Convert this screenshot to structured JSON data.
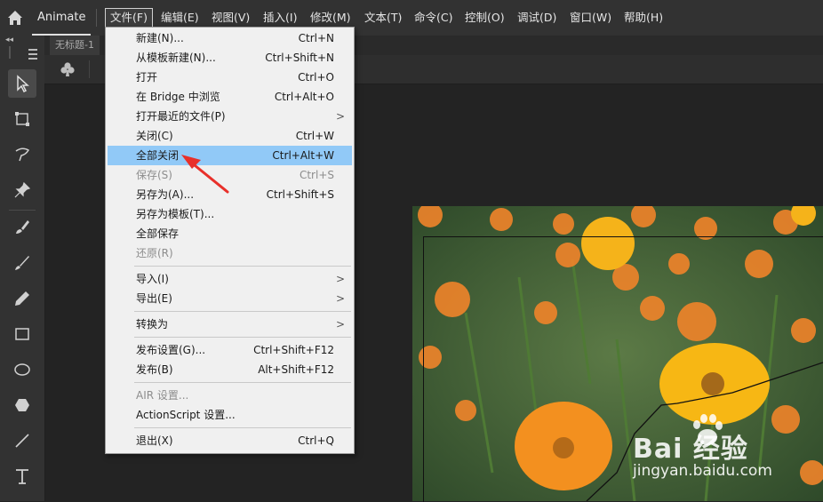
{
  "menubar": {
    "app_name": "Animate",
    "items": [
      "文件(F)",
      "编辑(E)",
      "视图(V)",
      "插入(I)",
      "修改(M)",
      "文本(T)",
      "命令(C)",
      "控制(O)",
      "调试(D)",
      "窗口(W)",
      "帮助(H)"
    ]
  },
  "document": {
    "tab_title": "无标题-1"
  },
  "file_menu": {
    "items": [
      {
        "label": "新建(N)...",
        "shortcut": "Ctrl+N"
      },
      {
        "label": "从模板新建(N)...",
        "shortcut": "Ctrl+Shift+N"
      },
      {
        "label": "打开",
        "shortcut": "Ctrl+O"
      },
      {
        "label": "在 Bridge 中浏览",
        "shortcut": "Ctrl+Alt+O"
      },
      {
        "label": "打开最近的文件(P)",
        "shortcut": "",
        "submenu": ">"
      },
      {
        "label": "关闭(C)",
        "shortcut": "Ctrl+W"
      },
      {
        "label": "全部关闭",
        "shortcut": "Ctrl+Alt+W"
      },
      {
        "label": "保存(S)",
        "shortcut": "Ctrl+S"
      },
      {
        "label": "另存为(A)...",
        "shortcut": "Ctrl+Shift+S"
      },
      {
        "label": "另存为模板(T)...",
        "shortcut": ""
      },
      {
        "label": "全部保存",
        "shortcut": ""
      },
      {
        "label": "还原(R)",
        "shortcut": ""
      },
      {
        "label": "导入(I)",
        "shortcut": "",
        "submenu": ">"
      },
      {
        "label": "导出(E)",
        "shortcut": "",
        "submenu": ">"
      },
      {
        "label": "转换为",
        "shortcut": "",
        "submenu": ">"
      },
      {
        "label": "发布设置(G)...",
        "shortcut": "Ctrl+Shift+F12"
      },
      {
        "label": "发布(B)",
        "shortcut": "Alt+Shift+F12"
      },
      {
        "label": "AIR 设置...",
        "shortcut": ""
      },
      {
        "label": "ActionScript 设置...",
        "shortcut": ""
      },
      {
        "label": "退出(X)",
        "shortcut": "Ctrl+Q"
      }
    ]
  },
  "watermark": {
    "logo": "Bai 经验",
    "url": "jingyan.baidu.com"
  },
  "colors": {
    "highlight": "#91c9f7",
    "menubar": "#323232",
    "annotation_arrow": "#e8302a"
  }
}
